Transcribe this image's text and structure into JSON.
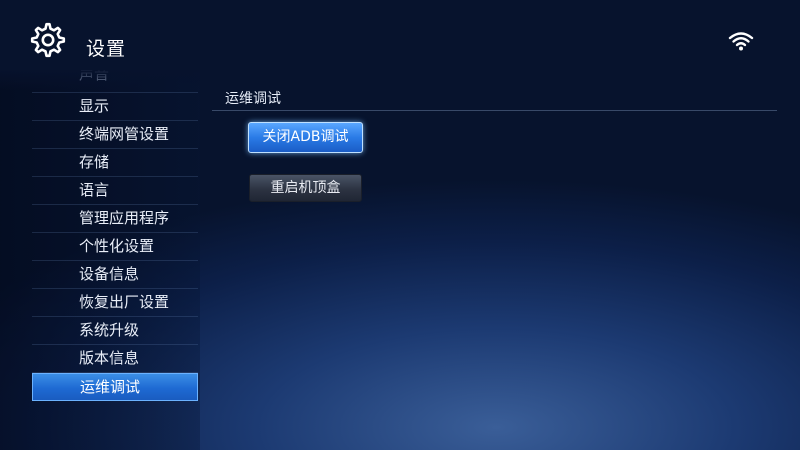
{
  "header": {
    "title": "设置",
    "settings_icon": "gear-icon",
    "status_icon": "wifi-icon"
  },
  "sidebar": {
    "items": [
      {
        "label": "声音",
        "partial": true
      },
      {
        "label": "显示"
      },
      {
        "label": "终端网管设置"
      },
      {
        "label": "存储"
      },
      {
        "label": "语言"
      },
      {
        "label": "管理应用程序"
      },
      {
        "label": "个性化设置"
      },
      {
        "label": "设备信息"
      },
      {
        "label": "恢复出厂设置"
      },
      {
        "label": "系统升级"
      },
      {
        "label": "版本信息"
      },
      {
        "label": "运维调试",
        "active": true
      }
    ]
  },
  "main": {
    "section_title": "运维调试",
    "buttons": [
      {
        "label": "关闭ADB调试",
        "focused": true
      },
      {
        "label": "重启机顶盒"
      }
    ]
  },
  "colors": {
    "accent": "#2a7be6",
    "focus_border": "#bfe0ff",
    "background": "#0c1f48"
  }
}
